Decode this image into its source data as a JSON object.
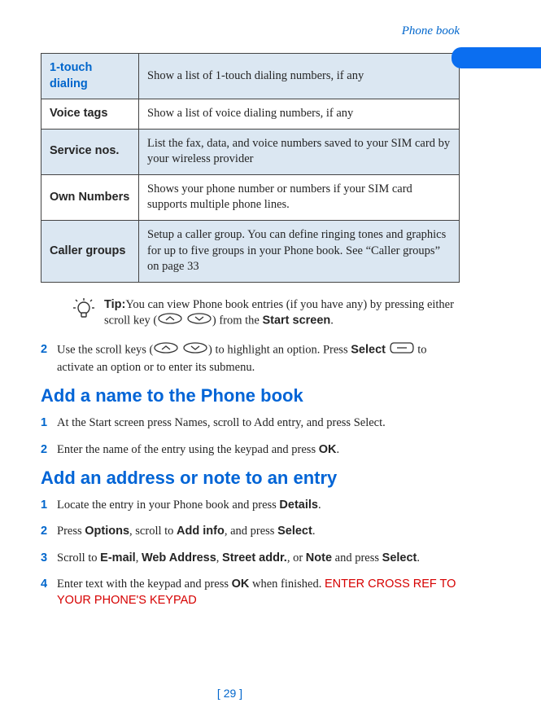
{
  "header": {
    "section_title": "Phone book"
  },
  "table": {
    "rows": [
      {
        "label": "1-touch dialing",
        "text": "Show a list of 1-touch dialing numbers, if any"
      },
      {
        "label": "Voice tags",
        "text": "Show a list of voice dialing numbers, if any"
      },
      {
        "label": "Service nos.",
        "text": "List the fax, data, and voice numbers saved to your SIM card by your wireless provider"
      },
      {
        "label": "Own Numbers",
        "text": "Shows your phone number or numbers if your SIM card supports multiple phone lines."
      },
      {
        "label": "Caller groups",
        "text": "Setup a caller group. You can define ringing tones and graphics for up to five groups in your Phone book. See “Caller groups” on page 33"
      }
    ]
  },
  "tip": {
    "label": "Tip:",
    "text_before": "You can view Phone book entries (if you have any) by pressing either scroll key (",
    "text_mid": ") from the ",
    "bold_target": "Start screen",
    "text_after": "."
  },
  "step2": {
    "num": "2",
    "t1": "Use the scroll keys (",
    "t2": ") to highlight an option. Press ",
    "select": "Select",
    "t3": " to activate an option or to enter its submenu."
  },
  "section_a": {
    "title": "Add a name to the Phone book",
    "steps": [
      {
        "num": "1",
        "parts": [
          "At the Start screen press Names, scroll to Add entry, and press Select."
        ]
      },
      {
        "num": "2",
        "parts_bold_ok": {
          "pre": "Enter the name of the entry using the keypad and press ",
          "bold": "OK",
          "post": "."
        }
      }
    ]
  },
  "section_b": {
    "title": "Add an address or note to an entry",
    "s1": {
      "num": "1",
      "pre": "Locate the entry in your Phone book and press ",
      "b1": "Details",
      "post": "."
    },
    "s2": {
      "num": "2",
      "pre": "Press ",
      "b1": "Options",
      "mid1": ", scroll to ",
      "b2": "Add info",
      "mid2": ", and press ",
      "b3": "Select",
      "post": "."
    },
    "s3": {
      "num": "3",
      "pre": "Scroll to ",
      "b1": "E-mail",
      "c1": ", ",
      "b2": "Web Address",
      "c2": ", ",
      "b3": "Street addr.",
      "c3": ", or ",
      "b4": "Note",
      "mid": " and press ",
      "b5": "Select",
      "post": "."
    },
    "s4": {
      "num": "4",
      "pre": "Enter text with the keypad and press ",
      "b1": "OK",
      "mid": " when finished. ",
      "cross": "ENTER CROSS REF TO YOUR PHONE'S KEYPAD"
    }
  },
  "footer": {
    "page": "[ 29 ]"
  }
}
